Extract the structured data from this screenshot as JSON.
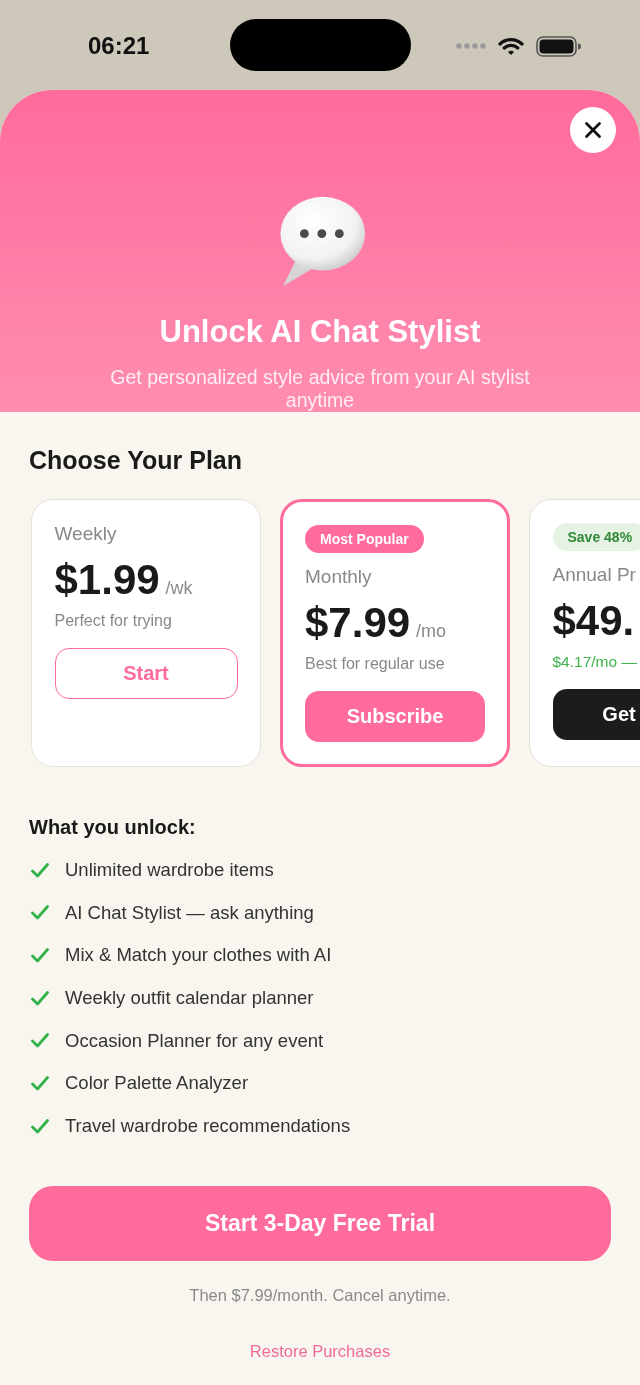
{
  "status_bar": {
    "time": "06:21"
  },
  "header": {
    "title": "Unlock AI Chat Stylist",
    "subtitle": "Get personalized style advice from your AI stylist anytime"
  },
  "plans_heading": "Choose Your Plan",
  "plans": [
    {
      "name": "Weekly",
      "price": "$1.99",
      "period": "/wk",
      "note": {
        "text": "Perfect for trying",
        "kind": "tagline"
      },
      "button": {
        "label": "Start",
        "kind": "outline"
      },
      "selected": false
    },
    {
      "badge": {
        "text": "Most Popular",
        "kind": "popular"
      },
      "name": "Monthly",
      "price": "$7.99",
      "period": "/mo",
      "note": {
        "text": "Best for regular use",
        "kind": "tagline"
      },
      "button": {
        "label": "Subscribe",
        "kind": "filled"
      },
      "selected": true
    },
    {
      "badge": {
        "text": "Save 48%",
        "kind": "savings"
      },
      "name": "Annual Pr",
      "price": "$49.",
      "note": {
        "text": "$4.17/mo —",
        "kind": "savings"
      },
      "button": {
        "label": "Get",
        "kind": "dark"
      },
      "selected": false
    }
  ],
  "features": {
    "title": "What you unlock:",
    "items": [
      "Unlimited wardrobe items",
      "AI Chat Stylist — ask anything",
      "Mix & Match your clothes with AI",
      "Weekly outfit calendar planner",
      "Occasion Planner for any event",
      "Color Palette Analyzer",
      "Travel wardrobe recommendations"
    ]
  },
  "cta": {
    "label": "Start 3-Day Free Trial"
  },
  "terms": "Then $7.99/month. Cancel anytime.",
  "restore": "Restore Purchases"
}
